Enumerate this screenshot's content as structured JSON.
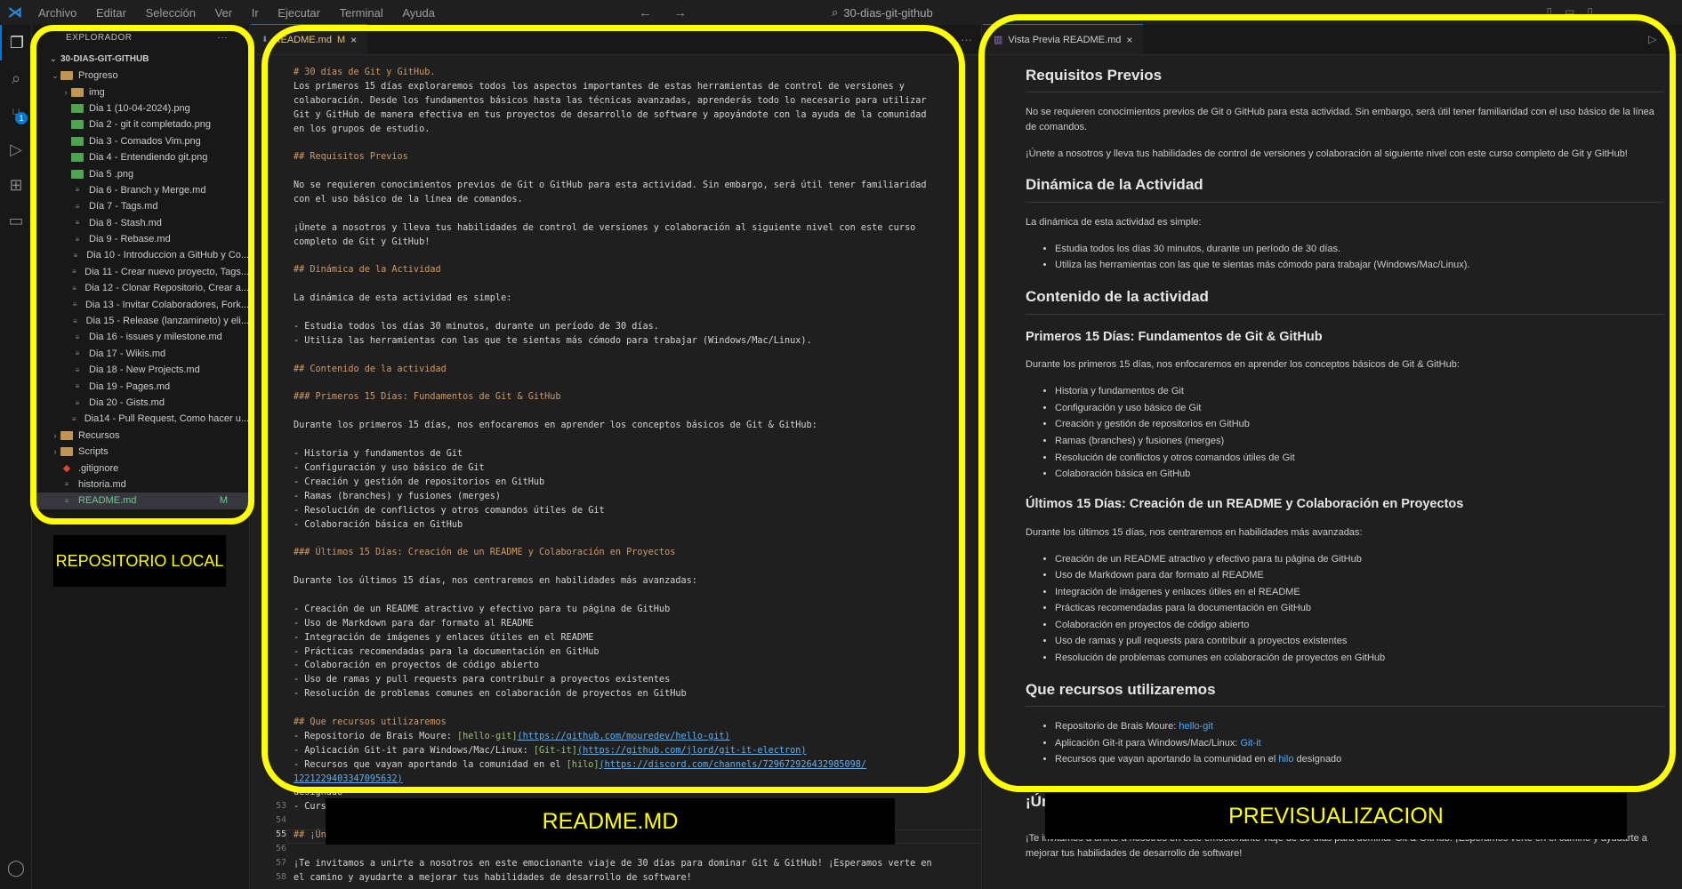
{
  "titlebar": {
    "menu": [
      "Archivo",
      "Editar",
      "Selección",
      "Ver",
      "Ir",
      "Ejecutar",
      "Terminal",
      "Ayuda"
    ],
    "search": "30-dias-git-github"
  },
  "explorer": {
    "header": "EXPLORADOR",
    "root": "30-DIAS-GIT-GITHUB",
    "tree": [
      {
        "level": 1,
        "kind": "folder",
        "chev": "⌄",
        "label": "Progreso"
      },
      {
        "level": 2,
        "kind": "folder",
        "chev": "›",
        "label": "img"
      },
      {
        "level": 2,
        "kind": "png",
        "label": "Dia 1 (10-04-2024).png"
      },
      {
        "level": 2,
        "kind": "png",
        "label": "Dia 2 - git it completado.png"
      },
      {
        "level": 2,
        "kind": "png",
        "label": "Dia 3 - Comados Vim.png"
      },
      {
        "level": 2,
        "kind": "png",
        "label": "Dia 4 - Entendiendo git.png"
      },
      {
        "level": 2,
        "kind": "png",
        "label": "Dia 5 .png"
      },
      {
        "level": 2,
        "kind": "md",
        "label": "Dia 6 - Branch y Merge.md"
      },
      {
        "level": 2,
        "kind": "md",
        "label": "Día 7 - Tags.md"
      },
      {
        "level": 2,
        "kind": "md",
        "label": "Dia 8 - Stash.md"
      },
      {
        "level": 2,
        "kind": "md",
        "label": "Dia 9 - Rebase.md"
      },
      {
        "level": 2,
        "kind": "md",
        "label": "Dia 10 - Introduccion a GitHub y Co..."
      },
      {
        "level": 2,
        "kind": "md",
        "label": "Dia 11 - Crear nuevo proyecto, Tags..."
      },
      {
        "level": 2,
        "kind": "md",
        "label": "Dia 12 - Clonar Repositorio, Crear a..."
      },
      {
        "level": 2,
        "kind": "md",
        "label": "Dia 13 - Invitar Colaboradores, Fork..."
      },
      {
        "level": 2,
        "kind": "md",
        "label": "Dia 15 - Release (lanzamineto) y eli..."
      },
      {
        "level": 2,
        "kind": "md",
        "label": "Dia 16 - issues y milestone.md"
      },
      {
        "level": 2,
        "kind": "md",
        "label": "Dia 17 - Wikis.md"
      },
      {
        "level": 2,
        "kind": "md",
        "label": "Dia 18 - New Projects.md"
      },
      {
        "level": 2,
        "kind": "md",
        "label": "Dia 19 - Pages.md"
      },
      {
        "level": 2,
        "kind": "md",
        "label": "Dia 20 - Gists.md"
      },
      {
        "level": 2,
        "kind": "md",
        "label": "Dia14 - Pull Request, Como hacer u..."
      },
      {
        "level": 1,
        "kind": "folder",
        "chev": "›",
        "label": "Recursos"
      },
      {
        "level": 1,
        "kind": "folder",
        "chev": "›",
        "label": "Scripts"
      },
      {
        "level": 1,
        "kind": "git",
        "label": ".gitignore"
      },
      {
        "level": 1,
        "kind": "md",
        "label": "historia.md"
      },
      {
        "level": 1,
        "kind": "md",
        "label": "README.md",
        "mark": "M",
        "active": true
      }
    ]
  },
  "editor": {
    "tab_label": "README.md",
    "tab_mark": "M",
    "lines": [
      {
        "t": "# 30 días de Git y GitHub.",
        "c": "h"
      },
      {
        "t": "Los primeros 15 días exploraremos todos los aspectos importantes de estas herramientas de control de versiones y"
      },
      {
        "t": "colaboración. Desde los fundamentos básicos hasta las técnicas avanzadas, aprenderás todo lo necesario para utilizar"
      },
      {
        "t": "Git y GitHub de manera efectiva en tus proyectos de desarrollo de software y apoyándote con la ayuda de la comunidad"
      },
      {
        "t": "en los grupos de estudio."
      },
      {
        "t": ""
      },
      {
        "t": "## Requisitos Previos",
        "c": "h"
      },
      {
        "t": ""
      },
      {
        "t": "No se requieren conocimientos previos de Git o GitHub para esta actividad. Sin embargo, será útil tener familiaridad"
      },
      {
        "t": "con el uso básico de la línea de comandos."
      },
      {
        "t": ""
      },
      {
        "t": "¡Únete a nosotros y lleva tus habilidades de control de versiones y colaboración al siguiente nivel con este curso"
      },
      {
        "t": "completo de Git y GitHub!"
      },
      {
        "t": ""
      },
      {
        "t": "## Dinámica de la Actividad",
        "c": "h"
      },
      {
        "t": ""
      },
      {
        "t": "La dinámica de esta actividad es simple:"
      },
      {
        "t": ""
      },
      {
        "t": "- Estudia todos los días 30 minutos, durante un período de 30 días."
      },
      {
        "t": "- Utiliza las herramientas con las que te sientas más cómodo para trabajar (Windows/Mac/Linux)."
      },
      {
        "t": ""
      },
      {
        "t": "## Contenido de la actividad",
        "c": "h"
      },
      {
        "t": ""
      },
      {
        "t": "### Primeros 15 Días: Fundamentos de Git & GitHub",
        "c": "h"
      },
      {
        "t": ""
      },
      {
        "t": "Durante los primeros 15 días, nos enfocaremos en aprender los conceptos básicos de Git & GitHub:"
      },
      {
        "t": ""
      },
      {
        "t": "- Historia y fundamentos de Git"
      },
      {
        "t": "- Configuración y uso básico de Git"
      },
      {
        "t": "- Creación y gestión de repositorios en GitHub"
      },
      {
        "t": "- Ramas (branches) y fusiones (merges)"
      },
      {
        "t": "- Resolución de conflictos y otros comandos útiles de Git"
      },
      {
        "t": "- Colaboración básica en GitHub"
      },
      {
        "t": ""
      },
      {
        "t": "### Últimos 15 Días: Creación de un README y Colaboración en Proyectos",
        "c": "h"
      },
      {
        "t": ""
      },
      {
        "t": "Durante los últimos 15 días, nos centraremos en habilidades más avanzadas:"
      },
      {
        "t": ""
      },
      {
        "t": "- Creación de un README atractivo y efectivo para tu página de GitHub"
      },
      {
        "t": "- Uso de Markdown para dar formato al README"
      },
      {
        "t": "- Integración de imágenes y enlaces útiles en el README"
      },
      {
        "t": "- Prácticas recomendadas para la documentación en GitHub"
      },
      {
        "t": "- Colaboración en proyectos de código abierto"
      },
      {
        "t": "- Uso de ramas y pull requests para contribuir a proyectos existentes"
      },
      {
        "t": "- Resolución de problemas comunes en colaboración de proyectos en GitHub"
      },
      {
        "t": ""
      },
      {
        "t": "## Que recursos utilizaremos",
        "c": "h"
      },
      {
        "p": "- Repositorio de Brais Moure: ",
        "lt": "[hello-git]",
        "lu": "(https://github.com/mouredev/hello-git)"
      },
      {
        "p": "- Aplicación Git-it para Windows/Mac/Linux: ",
        "lt": "[Git-it]",
        "lu": "(https://github.com/jlord/git-it-electron)"
      },
      {
        "p": "- Recursos que vayan aportando la comunidad en el ",
        "lt": "[hilo]",
        "lu": "(https://discord.com/channels/729672926432985098/"
      },
      {
        "p": "",
        "lt": "",
        "lu": "1221229403347095632)"
      },
      {
        "t": "designado"
      },
      {
        "t": "- Curso de Git & GitHub de [Udemy](https://udemy.com/curso/git-y-github-de-la-a-a-la-z/)"
      },
      {
        "t": ""
      },
      {
        "t": "## ¡Únete a nosotros!",
        "c": "h"
      },
      {
        "t": ""
      },
      {
        "t": "¡Te invitamos a unirte a nosotros en este emocionante viaje de 30 días para dominar Git & GitHub! ¡Esperamos verte en"
      },
      {
        "t": "el camino y ayudarte a mejorar tus habilidades de desarrollo de software!"
      }
    ],
    "line_numbers": [
      "53",
      "54",
      "55",
      "56",
      "57",
      "58"
    ]
  },
  "preview": {
    "tab_label": "Vista Previa README.md",
    "h2_requisitos": "Requisitos Previos",
    "p_requisitos": "No se requieren conocimientos previos de Git o GitHub para esta actividad. Sin embargo, será útil tener familiaridad con el uso básico de la línea de comandos.",
    "p_unete": "¡Únete a nosotros y lleva tus habilidades de control de versiones y colaboración al siguiente nivel con este curso completo de Git y GitHub!",
    "h2_dinamica": "Dinámica de la Actividad",
    "p_dinamica": "La dinámica de esta actividad es simple:",
    "list_dinamica": [
      "Estudia todos los días 30 minutos, durante un período de 30 días.",
      "Utiliza las herramientas con las que te sientas más cómodo para trabajar (Windows/Mac/Linux)."
    ],
    "h2_contenido": "Contenido de la actividad",
    "h3_primeros": "Primeros 15 Días: Fundamentos de Git & GitHub",
    "p_primeros": "Durante los primeros 15 días, nos enfocaremos en aprender los conceptos básicos de Git & GitHub:",
    "list_primeros": [
      "Historia y fundamentos de Git",
      "Configuración y uso básico de Git",
      "Creación y gestión de repositorios en GitHub",
      "Ramas (branches) y fusiones (merges)",
      "Resolución de conflictos y otros comandos útiles de Git",
      "Colaboración básica en GitHub"
    ],
    "h3_ultimos": "Últimos 15 Días: Creación de un README y Colaboración en Proyectos",
    "p_ultimos": "Durante los últimos 15 días, nos centraremos en habilidades más avanzadas:",
    "list_ultimos": [
      "Creación de un README atractivo y efectivo para tu página de GitHub",
      "Uso de Markdown para dar formato al README",
      "Integración de imágenes y enlaces útiles en el README",
      "Prácticas recomendadas para la documentación en GitHub",
      "Colaboración en proyectos de código abierto",
      "Uso de ramas y pull requests para contribuir a proyectos existentes",
      "Resolución de problemas comunes en colaboración de proyectos en GitHub"
    ],
    "h2_recursos": "Que recursos utilizaremos",
    "recursos": [
      {
        "text": "Repositorio de Brais Moure: ",
        "link": "hello-git",
        "after": ""
      },
      {
        "text": "Aplicación Git-it para Windows/Mac/Linux: ",
        "link": "Git-it",
        "after": ""
      },
      {
        "text": "Recursos que vayan aportando la comunidad en el ",
        "link": "hilo",
        "after": " designado"
      }
    ],
    "h2_unete_partial": "¡Ún",
    "p_final": "¡Te invitamos a unirte a nosotros en este emocionante viaje de 30 días para dominar Git & GitHub! ¡Esperamos verte en el camino y ayudarte a mejorar tus habilidades de desarrollo de software!"
  },
  "annotations": {
    "local": "REPOSITORIO LOCAL",
    "readme": "README.MD",
    "preview": "PREVISUALIZACION",
    "color": "#ffff00"
  }
}
